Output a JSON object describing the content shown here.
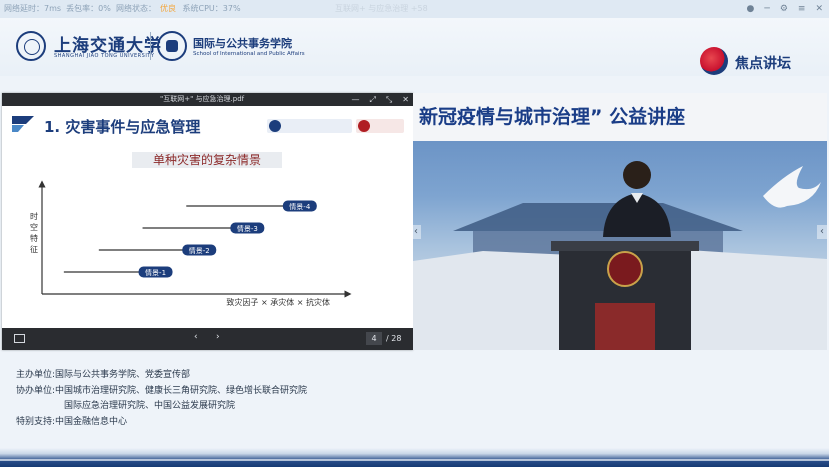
{
  "status_bar": {
    "latency_label": "网络延时：",
    "latency_value": "7ms",
    "loss_label": "丢包率：",
    "loss_value": "0%",
    "net_state_label": "网络状态：",
    "net_state_value": "优良",
    "cpu_label": "系统CPU：",
    "cpu_value": "37%",
    "overlay_text": "互联网+ 与应急治理 +58"
  },
  "header": {
    "sjtu_name": "上海交通大学",
    "sjtu_en": "SHANGHAI JIAO TONG UNIVERSITY",
    "school_name": "国际与公共事务学院",
    "school_en": "School of International and Public Affairs",
    "brand_name": "焦点讲坛"
  },
  "pdf_viewer": {
    "file_title": "\"互联网+\" 与应急治理.pdf",
    "current_page": "4",
    "total_pages": "/ 28"
  },
  "slide": {
    "title": "1. 灾害事件与应急管理",
    "subtitle": "单种灾害的复杂情景",
    "y_axis_label": "时空特征",
    "x_axis_label": "致灾因子 × 承灾体 × 抗灾体"
  },
  "chart_data": {
    "type": "line",
    "title": "单种灾害的复杂情景",
    "xlabel": "致灾因子 × 承灾体 × 抗灾体",
    "ylabel": "时空特征",
    "series": [
      {
        "name": "情景-1",
        "x": [
          0.5,
          2.3
        ],
        "y": [
          1,
          1
        ]
      },
      {
        "name": "情景-2",
        "x": [
          1.3,
          3.3
        ],
        "y": [
          2,
          2
        ]
      },
      {
        "name": "情景-3",
        "x": [
          2.3,
          4.4
        ],
        "y": [
          3,
          3
        ]
      },
      {
        "name": "情景-4",
        "x": [
          3.3,
          5.6
        ],
        "y": [
          4,
          4
        ]
      }
    ],
    "xlim": [
      0,
      7
    ],
    "ylim": [
      0,
      5
    ],
    "grid": false
  },
  "video": {
    "banner_text": "新冠疫情与城市治理” 公益讲座"
  },
  "info": {
    "host_label": "主办单位:",
    "host_value": "国际与公共事务学院、党委宣传部",
    "co_label": "协办单位:",
    "co_value_1": "中国城市治理研究院、健康长三角研究院、绿色增长联合研究院",
    "co_value_2": "国际应急治理研究院、中国公益发展研究院",
    "support_label": "特别支持:",
    "support_value": "中国金融信息中心"
  },
  "colors": {
    "brand_blue": "#1c3d7c",
    "scenario_box": "#1c3d7c",
    "status_good": "#f3a53a"
  }
}
